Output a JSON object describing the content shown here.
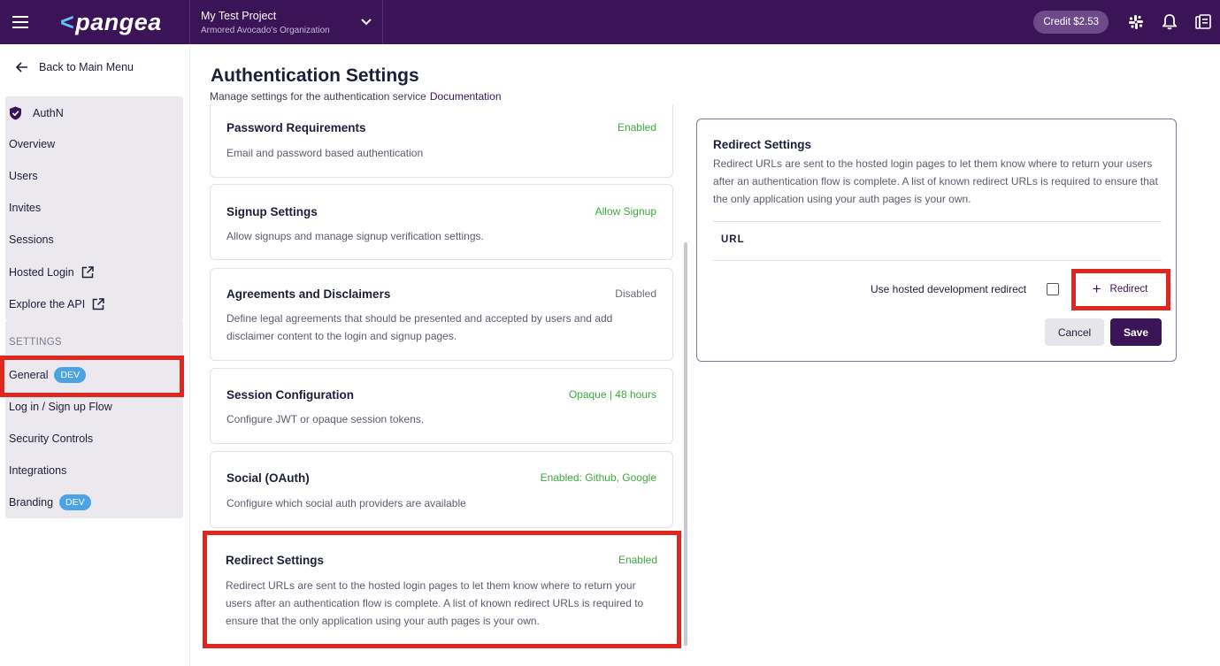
{
  "topbar": {
    "logo": "pangea",
    "logo_chevron": "<",
    "project_name": "My Test Project",
    "org_name": "Armored Avocado's Organization",
    "credit": "Credit $2.53",
    "icons": [
      "menu-icon",
      "chevron-down-icon",
      "slack-icon",
      "bell-icon",
      "docs-icon"
    ]
  },
  "sidebar": {
    "back_label": "Back to Main Menu",
    "service": "AuthN",
    "items": [
      {
        "label": "Overview"
      },
      {
        "label": "Users"
      },
      {
        "label": "Invites"
      },
      {
        "label": "Sessions"
      },
      {
        "label": "Hosted Login"
      },
      {
        "label": "Explore the API"
      }
    ],
    "settings_label": "SETTINGS",
    "settings_items": [
      {
        "label": "General",
        "badge": "DEV"
      },
      {
        "label": "Log in / Sign up Flow"
      },
      {
        "label": "Security Controls"
      },
      {
        "label": "Integrations"
      },
      {
        "label": "Branding",
        "badge": "DEV"
      }
    ]
  },
  "main": {
    "title": "Authentication Settings",
    "subtitle": "Manage settings for the authentication service",
    "doc_link": "Documentation",
    "cards": [
      {
        "title": "Password Requirements",
        "status": "Enabled",
        "desc": "Email and password based authentication"
      },
      {
        "title": "Signup Settings",
        "status": "Allow Signup",
        "desc": "Allow signups and manage signup verification settings."
      },
      {
        "title": "Agreements and Disclaimers",
        "status": "Disabled",
        "desc": "Define legal agreements that should be presented and accepted by users and add disclaimer content to the login and signup pages."
      },
      {
        "title": "Session Configuration",
        "status": "Opaque | 48 hours",
        "desc": "Configure JWT or opaque session tokens."
      },
      {
        "title": "Social (OAuth)",
        "status": "Enabled: Github, Google",
        "desc": "Configure which social auth providers are available"
      },
      {
        "title": "Redirect Settings",
        "status": "Enabled",
        "desc": "Redirect URLs are sent to the hosted login pages to let them know where to return your users after an authentication flow is complete. A list of known redirect URLs is required to ensure that the only application using your auth pages is your own."
      }
    ]
  },
  "panel": {
    "title": "Redirect Settings",
    "desc": "Redirect URLs are sent to the hosted login pages to let them know where to return your users after an authentication flow is complete. A list of known redirect URLs is required to ensure that the only application using your auth pages is your own.",
    "url_header": "URL",
    "dev_redirect_label": "Use hosted development redirect",
    "redirect_button": "Redirect",
    "plus": "+",
    "cancel": "Cancel",
    "save": "Save"
  },
  "colors": {
    "brand": "#3b1458",
    "enabled": "#3caa3c",
    "badge": "#4ba3e3",
    "highlight": "#e0271f"
  }
}
